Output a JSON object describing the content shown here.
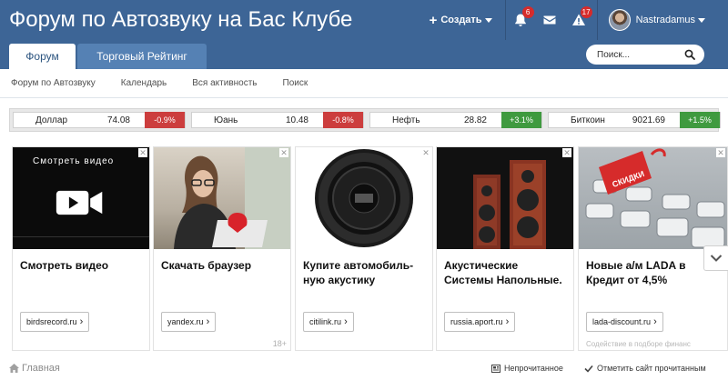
{
  "header": {
    "site_title": "Форум по Автозвуку на Бас Клубе",
    "create_label": "Создать",
    "alerts_count": "6",
    "notices_count": "17",
    "username": "Nastradamus"
  },
  "tabs": [
    {
      "label": "Форум"
    },
    {
      "label": "Торговый Рейтинг"
    }
  ],
  "search": {
    "placeholder": "Поиск..."
  },
  "subnav": [
    "Форум по Автозвуку",
    "Календарь",
    "Вся активность",
    "Поиск"
  ],
  "ticker": [
    {
      "name": "Доллар",
      "value": "74.08",
      "change": "-0.9%",
      "dir": "down"
    },
    {
      "name": "Юань",
      "value": "10.48",
      "change": "-0.8%",
      "dir": "down"
    },
    {
      "name": "Нефть",
      "value": "28.82",
      "change": "+3.1%",
      "dir": "up"
    },
    {
      "name": "Биткоин",
      "value": "9021.69",
      "change": "+1.5%",
      "dir": "up"
    }
  ],
  "ads": [
    {
      "title": "Смотреть видео",
      "link": "birdsrecord.ru",
      "image_caption": "Смотреть видео"
    },
    {
      "title": "Скачать браузер",
      "link": "yandex.ru",
      "age": "18+"
    },
    {
      "title": "Купите автомобиль-ную акустику",
      "link": "citilink.ru"
    },
    {
      "title": "Акустические Системы Напольные.",
      "link": "russia.aport.ru"
    },
    {
      "title": "Новые а/м LADA в Кредит от 4,5%",
      "link": "lada-discount.ru",
      "image_caption": "СКИДКИ",
      "disclaimer": "Содействие в подборе финанс"
    }
  ],
  "footer": {
    "home": "Главная",
    "unread": "Непрочитанное",
    "mark_read": "Отметить сайт прочитанным"
  },
  "colors": {
    "header_bg": "#3d6596",
    "tab_inactive": "#5581b4",
    "down": "#cc3d3d",
    "up": "#3f9a3f",
    "badge": "#d62b2b"
  }
}
